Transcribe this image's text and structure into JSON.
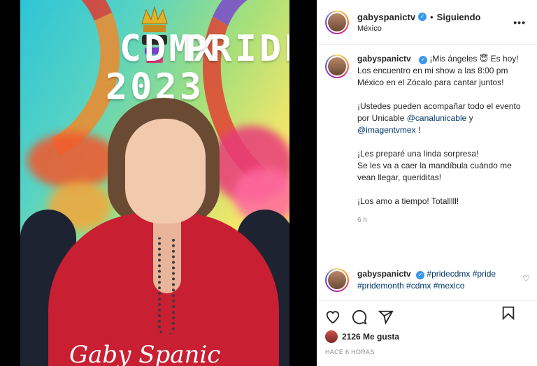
{
  "poster": {
    "line1_left": "CDMX",
    "line1_right": "PRIDE",
    "line2": "2023",
    "signature": "Gaby Spanic"
  },
  "post": {
    "username": "gabyspanictv",
    "verified_mark": "✓",
    "separator": "•",
    "follow_status": "Siguiendo",
    "location": "México",
    "more_label": "•••"
  },
  "caption": {
    "username": "gabyspanictv",
    "lines": [
      "¡Mis ángeles 😇 Es hoy!",
      "Los encuentro en mi show a las 8:00 pm México en el Zócalo para cantar juntos!",
      "¡Ustedes pueden acompañar todo el evento por Unicable",
      "@canalunicable",
      "y",
      "@imagentvmex",
      "!",
      "¡Les preparé una linda sorpresa!",
      "Se les va a caer la mandíbula cuándo me vean llegar, queriditas!",
      "¡Los amo a tiempo! Totalllll!"
    ],
    "time": "6 h"
  },
  "comment": {
    "username": "gabyspanictv",
    "hashtags_line1": "#pridecdmx #pride",
    "hashtags_line2": "#pridemonth #cdmx #mexico",
    "heart": "♡"
  },
  "actions": {
    "likes": "2126 Me gusta",
    "date": "HACE 6 HORAS"
  },
  "colors": {
    "verified": "#3897f0",
    "mention": "#00376b",
    "muted": "#8e8e8e"
  },
  "icons": [
    "heart-icon",
    "comment-icon",
    "share-icon",
    "bookmark-icon",
    "more-icon",
    "verified-icon",
    "crown-icon"
  ]
}
